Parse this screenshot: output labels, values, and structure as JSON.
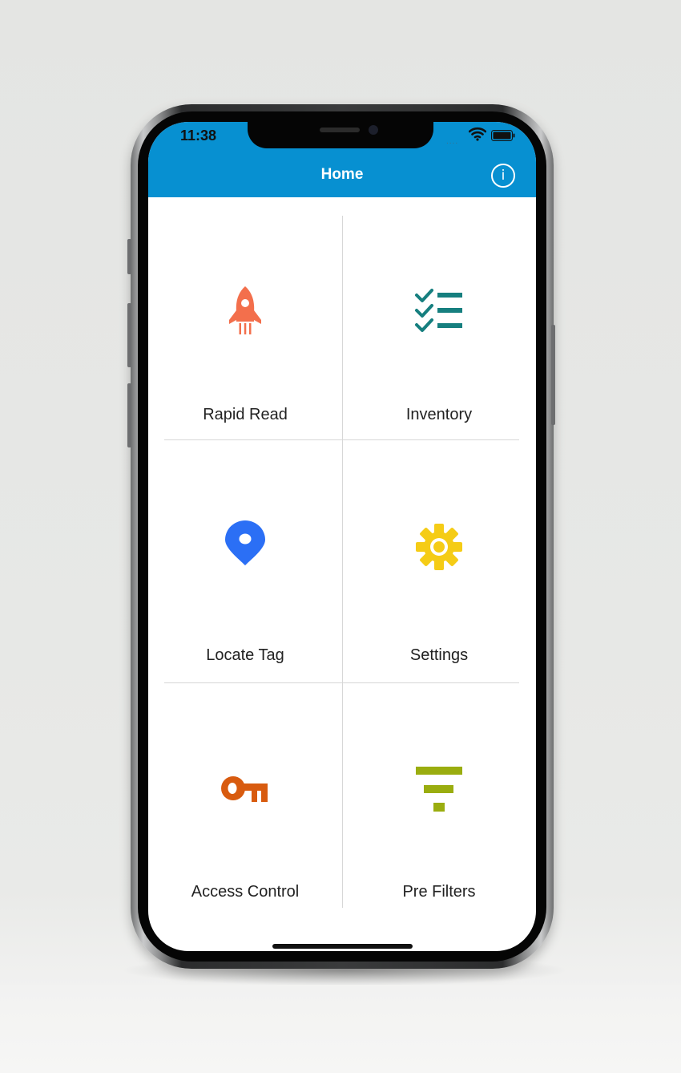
{
  "status_bar": {
    "time": "11:38",
    "signal": "....",
    "wifi_icon": "wifi-icon",
    "battery_icon": "battery-icon"
  },
  "nav": {
    "title": "Home",
    "info_glyph": "i",
    "color": "#0790d1"
  },
  "tiles": [
    {
      "label": "Rapid Read",
      "icon": "rocket-icon",
      "color": "#f36f4c"
    },
    {
      "label": "Inventory",
      "icon": "checklist-icon",
      "color": "#167f7f"
    },
    {
      "label": "Locate Tag",
      "icon": "location-pin-icon",
      "color": "#2b6ff5"
    },
    {
      "label": "Settings",
      "icon": "gear-icon",
      "color": "#f5cc16"
    },
    {
      "label": "Access Control",
      "icon": "key-icon",
      "color": "#d85b0f"
    },
    {
      "label": "Pre Filters",
      "icon": "filter-icon",
      "color": "#9aad0f"
    }
  ]
}
